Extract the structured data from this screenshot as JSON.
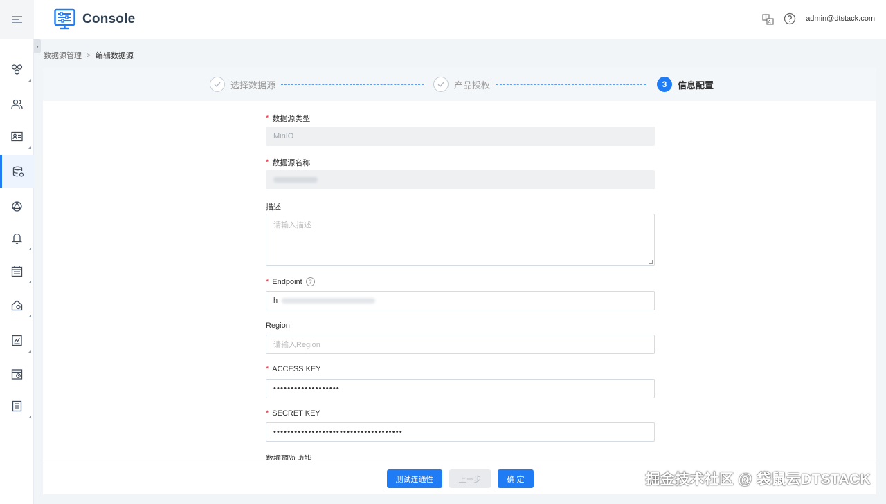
{
  "header": {
    "app_title": "Console",
    "user": "admin@dtstack.com",
    "lang_icon": "language-icon",
    "help_icon": "help-icon"
  },
  "breadcrumb": {
    "parent": "数据源管理",
    "current": "编辑数据源",
    "separator": ">"
  },
  "steps": [
    {
      "label": "选择数据源",
      "state": "done"
    },
    {
      "label": "产品授权",
      "state": "done"
    },
    {
      "number": "3",
      "label": "信息配置",
      "state": "current"
    }
  ],
  "form": {
    "type_label": "数据源类型",
    "type_value": "MinIO",
    "name_label": "数据源名称",
    "desc_label": "描述",
    "desc_placeholder": "请输入描述",
    "endpoint_label": "Endpoint",
    "endpoint_help": "?",
    "endpoint_value_visible": "h",
    "region_label": "Region",
    "region_placeholder": "请输入Region",
    "access_key_label": "ACCESS KEY",
    "access_key_value": "•••••••••••••••••••",
    "secret_key_label": "SECRET KEY",
    "secret_key_value": "•••••••••••••••••••••••••••••••••••••",
    "preview_label": "数据预览功能"
  },
  "buttons": {
    "test": "测试连通性",
    "prev": "上一步",
    "confirm": "确 定"
  },
  "watermark": "掘金技术社区 @ 袋鼠云DTSTACK",
  "sidebar": {
    "icons": [
      "cluster-icon",
      "users-icon",
      "id-card-icon",
      "datasource-icon",
      "network-icon",
      "bell-icon",
      "calendar-icon",
      "home-settings-icon",
      "chart-report-icon",
      "window-clock-icon",
      "document-icon"
    ],
    "active": "datasource-icon"
  },
  "colors": {
    "primary": "#1f7cf5",
    "required": "#f5222d"
  }
}
